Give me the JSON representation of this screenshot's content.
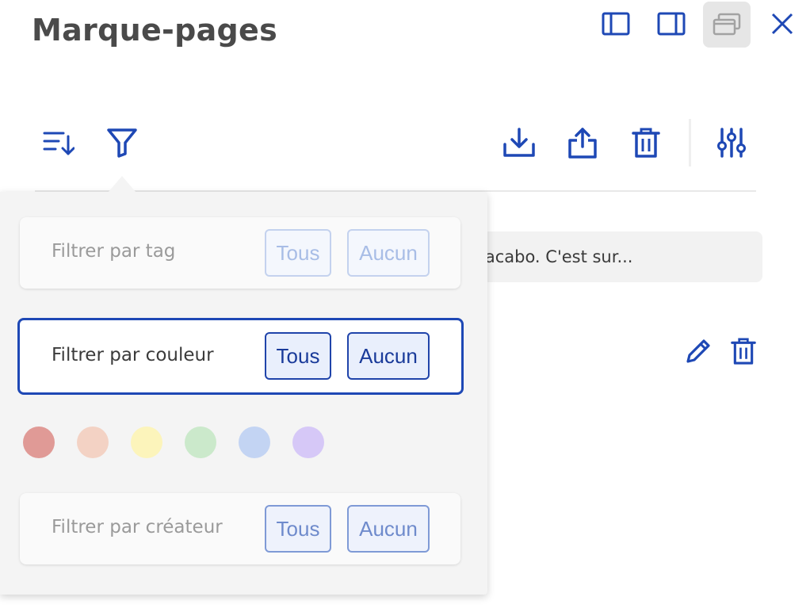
{
  "panel": {
    "title": "Marque-pages"
  },
  "window_controls": [
    {
      "name": "dock-left-icon"
    },
    {
      "name": "dock-right-icon"
    },
    {
      "name": "float-window-icon",
      "active": true
    },
    {
      "name": "close-icon"
    }
  ],
  "toolbar": {
    "left": [
      "sort-icon",
      "filter-icon"
    ],
    "right": [
      "import-icon",
      "export-icon",
      "delete-all-icon",
      "settings-sliders-icon"
    ]
  },
  "bookmark": {
    "snippet": "iacabo. C'est sur..."
  },
  "filter_popup": {
    "tag": {
      "label": "Filtrer par tag",
      "all": "Tous",
      "none": "Aucun",
      "state": "disabled"
    },
    "color": {
      "label": "Filtrer par couleur",
      "all": "Tous",
      "none": "Aucun",
      "state": "focused"
    },
    "creator": {
      "label": "Filtrer par créateur",
      "all": "Tous",
      "none": "Aucun",
      "state": "inactive"
    },
    "swatches": [
      "#e09a96",
      "#f3d2c4",
      "#fcf4bb",
      "#cbe9cb",
      "#c3d4f3",
      "#d6c8f7"
    ]
  },
  "colors": {
    "accent": "#1e48b5",
    "popup_bg": "#f4f4f4"
  }
}
